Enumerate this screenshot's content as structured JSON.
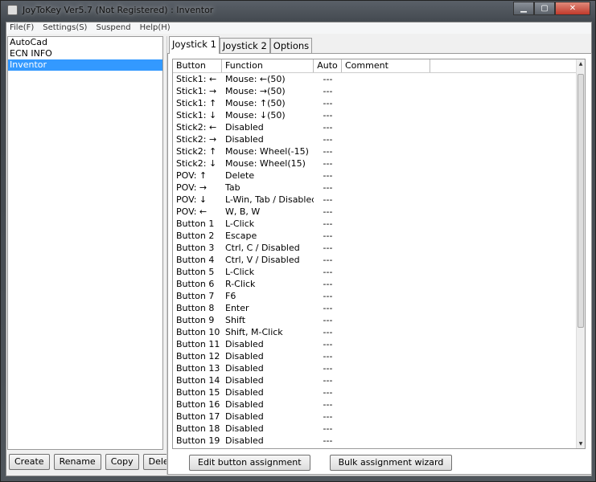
{
  "window": {
    "title": "JoyToKey Ver5.7 (Not Registered) : Inventor",
    "controls": [
      "minimize",
      "maximize",
      "close"
    ]
  },
  "menu": [
    "File(F)",
    "Settings(S)",
    "Suspend",
    "Help(H)"
  ],
  "profiles": {
    "items": [
      "AutoCad",
      "ECN INFO",
      "Inventor"
    ],
    "selected": "Inventor"
  },
  "profile_buttons": [
    "Create",
    "Rename",
    "Copy",
    "Delete"
  ],
  "tabs": {
    "items": [
      "Joystick 1",
      "Joystick 2",
      "Options"
    ],
    "active": "Joystick 1"
  },
  "table": {
    "columns": [
      "Button",
      "Function",
      "Auto",
      "Comment"
    ],
    "rows": [
      [
        "Stick1: ←",
        "Mouse: ←(50)",
        "---",
        ""
      ],
      [
        "Stick1: →",
        "Mouse: →(50)",
        "---",
        ""
      ],
      [
        "Stick1: ↑",
        "Mouse: ↑(50)",
        "---",
        ""
      ],
      [
        "Stick1: ↓",
        "Mouse: ↓(50)",
        "---",
        ""
      ],
      [
        "Stick2: ←",
        "Disabled",
        "---",
        ""
      ],
      [
        "Stick2: →",
        "Disabled",
        "---",
        ""
      ],
      [
        "Stick2: ↑",
        "Mouse: Wheel(-15)",
        "---",
        ""
      ],
      [
        "Stick2: ↓",
        "Mouse: Wheel(15)",
        "---",
        ""
      ],
      [
        "POV: ↑",
        "Delete",
        "---",
        ""
      ],
      [
        "POV: →",
        "Tab",
        "---",
        ""
      ],
      [
        "POV: ↓",
        "L-Win, Tab / Disabled",
        "---",
        ""
      ],
      [
        "POV: ←",
        "W, B, W",
        "---",
        ""
      ],
      [
        "Button 1",
        "L-Click",
        "---",
        ""
      ],
      [
        "Button 2",
        "Escape",
        "---",
        ""
      ],
      [
        "Button 3",
        "Ctrl, C / Disabled",
        "---",
        ""
      ],
      [
        "Button 4",
        "Ctrl, V / Disabled",
        "---",
        ""
      ],
      [
        "Button 5",
        "L-Click",
        "---",
        ""
      ],
      [
        "Button 6",
        "R-Click",
        "---",
        ""
      ],
      [
        "Button 7",
        "F6",
        "---",
        ""
      ],
      [
        "Button 8",
        "Enter",
        "---",
        ""
      ],
      [
        "Button 9",
        "Shift",
        "---",
        ""
      ],
      [
        "Button 10",
        "Shift, M-Click",
        "---",
        ""
      ],
      [
        "Button 11",
        "Disabled",
        "---",
        ""
      ],
      [
        "Button 12",
        "Disabled",
        "---",
        ""
      ],
      [
        "Button 13",
        "Disabled",
        "---",
        ""
      ],
      [
        "Button 14",
        "Disabled",
        "---",
        ""
      ],
      [
        "Button 15",
        "Disabled",
        "---",
        ""
      ],
      [
        "Button 16",
        "Disabled",
        "---",
        ""
      ],
      [
        "Button 17",
        "Disabled",
        "---",
        ""
      ],
      [
        "Button 18",
        "Disabled",
        "---",
        ""
      ],
      [
        "Button 19",
        "Disabled",
        "---",
        ""
      ]
    ]
  },
  "actions": {
    "edit": "Edit button assignment",
    "bulk": "Bulk assignment wizard"
  }
}
